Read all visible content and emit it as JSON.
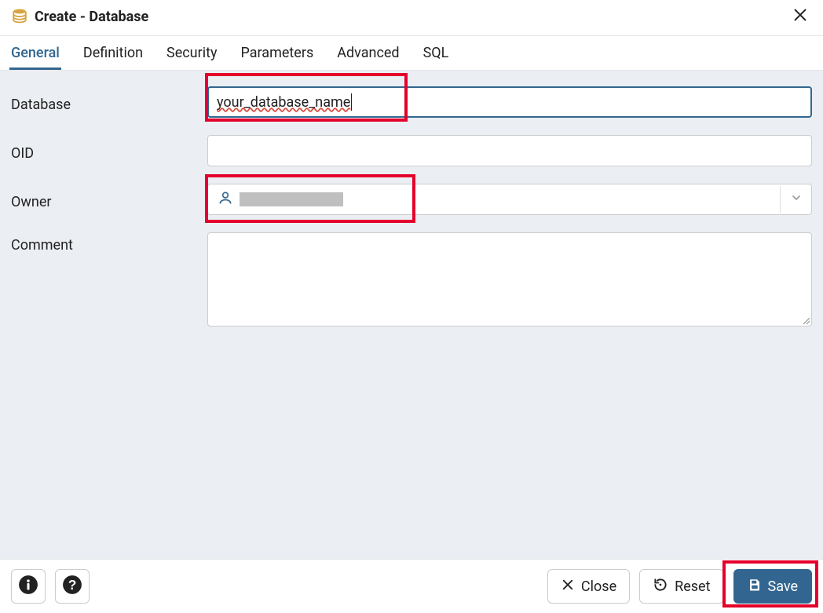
{
  "title": "Create - Database",
  "tabs": {
    "general": "General",
    "definition": "Definition",
    "security": "Security",
    "parameters": "Parameters",
    "advanced": "Advanced",
    "sql": "SQL"
  },
  "form": {
    "database_label": "Database",
    "database_value": "your_database_name",
    "oid_label": "OID",
    "oid_value": "",
    "owner_label": "Owner",
    "owner_value": "",
    "comment_label": "Comment",
    "comment_value": ""
  },
  "footer": {
    "close_label": "Close",
    "reset_label": "Reset",
    "save_label": "Save"
  }
}
